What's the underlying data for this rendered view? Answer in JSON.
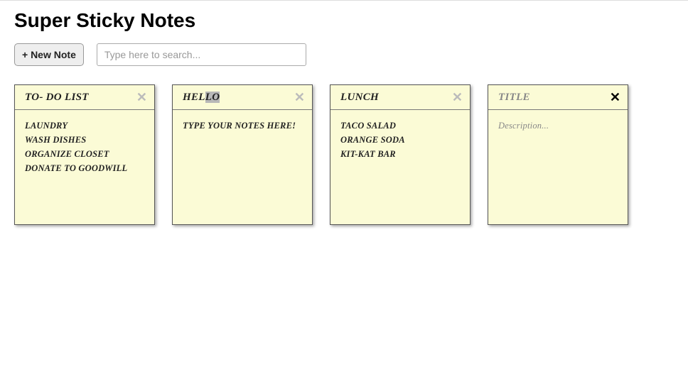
{
  "header": {
    "title": "Super Sticky Notes"
  },
  "toolbar": {
    "new_note_label": "+ New Note",
    "search_placeholder": "Type here to search..."
  },
  "notes": [
    {
      "title": "To- do list",
      "body": "Laundry\nWash dishes\nOrganize closet\nDonate to Goodwill",
      "close_style": "dim",
      "is_empty": false
    },
    {
      "title": "Hello",
      "body": "type your notes here!",
      "close_style": "dim",
      "is_empty": false,
      "title_partial_selection": true
    },
    {
      "title": "Lunch",
      "body": "Taco salad\norange soda\nKit-Kat bar",
      "close_style": "dim",
      "is_empty": false
    },
    {
      "title": "",
      "title_placeholder": "Title",
      "body": "",
      "body_placeholder": "Description...",
      "close_style": "strong",
      "is_empty": true
    }
  ]
}
